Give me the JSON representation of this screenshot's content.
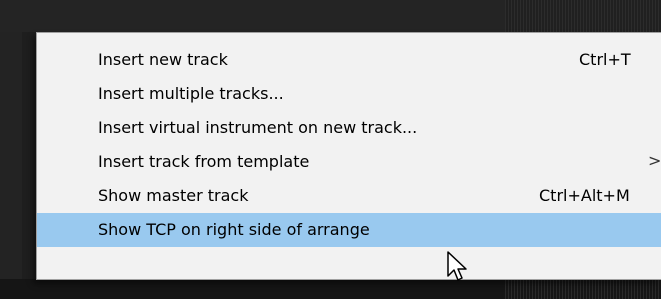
{
  "menu": {
    "items": [
      {
        "label": "Insert new track",
        "shortcut": "Ctrl+T"
      },
      {
        "label": "Insert multiple tracks...",
        "shortcut": ""
      },
      {
        "label": "Insert virtual instrument on new track...",
        "shortcut": ""
      },
      {
        "label": "Insert track from template",
        "shortcut": "",
        "submenu_arrow": ">"
      },
      {
        "label": "Show master track",
        "shortcut": "Ctrl+Alt+M"
      },
      {
        "label": "Show TCP on right side of arrange",
        "shortcut": "",
        "highlighted": true
      }
    ]
  },
  "colors": {
    "menu_background": "#f2f2f2",
    "highlight": "#99c9ef",
    "app_background": "#1e1e1e"
  },
  "icons": {
    "cursor": "mouse-pointer-icon",
    "submenu": "chevron-right-icon"
  }
}
